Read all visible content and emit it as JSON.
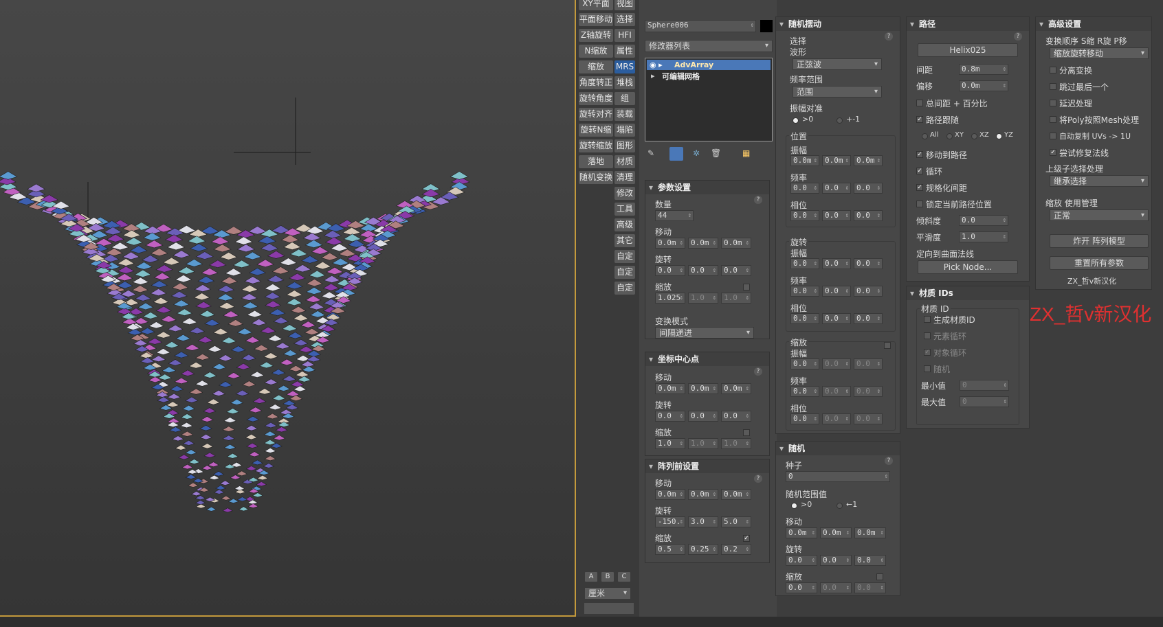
{
  "tools": [
    "XY平面",
    "视图",
    "平面移动",
    "选择",
    "Z轴旋转",
    "HFI",
    "N缩放",
    "属性",
    "缩放",
    "MRS",
    "角度转正",
    "堆栈",
    "旋转角度",
    "组",
    "旋转对齐",
    "装载",
    "旋转N缩",
    "塌陷",
    "旋转缩放",
    "图形",
    "落地",
    "材质",
    "随机变换",
    "清理",
    "修改",
    "工具",
    "高级",
    "其它",
    "自定",
    "自定",
    "自定"
  ],
  "units": {
    "abc": [
      "A",
      "B",
      "C"
    ],
    "unit": "厘米"
  },
  "modifier": {
    "object_name": "Sphere006",
    "list_label": "修改器列表",
    "stack": [
      "AdvArray",
      "可编辑网格"
    ]
  },
  "params": {
    "title": "参数设置",
    "count_label": "数量",
    "count": "44",
    "move_label": "移动",
    "move": [
      "0.0m",
      "0.0m",
      "0.0m"
    ],
    "rot_label": "旋转",
    "rot": [
      "0.0",
      "0.0",
      "0.0"
    ],
    "scale_label": "缩放",
    "scale": [
      "1.025",
      "1.0",
      "1.0"
    ],
    "mode_label": "变换模式",
    "mode": "间隔递进"
  },
  "pivot": {
    "title": "坐标中心点",
    "move_label": "移动",
    "move": [
      "0.0m",
      "0.0m",
      "0.0m"
    ],
    "rot_label": "旋转",
    "rot": [
      "0.0",
      "0.0",
      "0.0"
    ],
    "scale_label": "缩放",
    "scale": [
      "1.0",
      "1.0",
      "1.0"
    ]
  },
  "pre": {
    "title": "阵列前设置",
    "move_label": "移动",
    "move": [
      "0.0m",
      "0.0m",
      "0.0m"
    ],
    "rot_label": "旋转",
    "rot": [
      "-150.",
      "3.0",
      "5.0"
    ],
    "scale_label": "缩放",
    "scale": [
      "0.5",
      "0.25",
      "0.2"
    ]
  },
  "wobble": {
    "title": "随机摆动",
    "select": "选择",
    "wave": "波形",
    "wave_val": "正弦波",
    "freq_range": "频率范围",
    "freq_val": "范围",
    "amp": "振幅对准",
    "r1": ">0",
    "r2": "+-1",
    "pos": "位置",
    "rot": "旋转",
    "scale": "缩放",
    "amp_l": "振幅",
    "freq_l": "频率",
    "phase_l": "相位",
    "vals": [
      "0.0m",
      "0.0m",
      "0.0m"
    ],
    "zeros": [
      "0.0",
      "0.0",
      "0.0"
    ]
  },
  "random": {
    "title": "随机",
    "seed_label": "种子",
    "seed": "0",
    "range": "随机范围值",
    "r1": ">0",
    "r2": "←1",
    "move_label": "移动",
    "move": [
      "0.0m",
      "0.0m",
      "0.0m"
    ],
    "rot_label": "旋转",
    "rot": [
      "0.0",
      "0.0",
      "0.0"
    ],
    "scale_label": "缩放",
    "scale": [
      "0.0",
      "0.0",
      "0.0"
    ]
  },
  "path": {
    "title": "路径",
    "helix": "Helix025",
    "spacing_label": "间距",
    "spacing": "0.8m",
    "offset_label": "偏移",
    "offset": "0.0m",
    "total": "总间距 + 百分比",
    "follow": "路径跟随",
    "axes": [
      "All",
      "XY",
      "XZ",
      "YZ"
    ],
    "move_to": "移动到路径",
    "loop": "循环",
    "normalize": "规格化间距",
    "lock": "锁定当前路径位置",
    "tilt_label": "倾斜度",
    "tilt": "0.0",
    "smooth_label": "平滑度",
    "smooth": "1.0",
    "orient": "定向到曲面法线",
    "pick": "Pick Node..."
  },
  "mat": {
    "title": "材质 IDs",
    "group": "材质 ID",
    "gen": "生成材质ID",
    "elem": "元素循环",
    "obj": "对象循环",
    "rand": "随机",
    "min_label": "最小值",
    "min": "0",
    "max_label": "最大值",
    "max": "0"
  },
  "adv": {
    "title": "高级设置",
    "order": "变换顺序 S缩 R旋 P移",
    "order_val": "缩放旋转移动",
    "opts": [
      "分离变换",
      "跳过最后一个",
      "延迟处理",
      "将Poly按照Mesh处理",
      "自动复制 UVs -> 1U",
      "尝试修复法线"
    ],
    "parent_label": "上级子选择处理",
    "parent_val": "继承选择",
    "scale_label": "缩放 使用管理",
    "scale_val": "正常",
    "explode": "炸开 阵列模型",
    "reset": "重置所有参数",
    "credit": "ZX_哲v新汉化"
  },
  "brand": "ZX_哲v新汉化"
}
